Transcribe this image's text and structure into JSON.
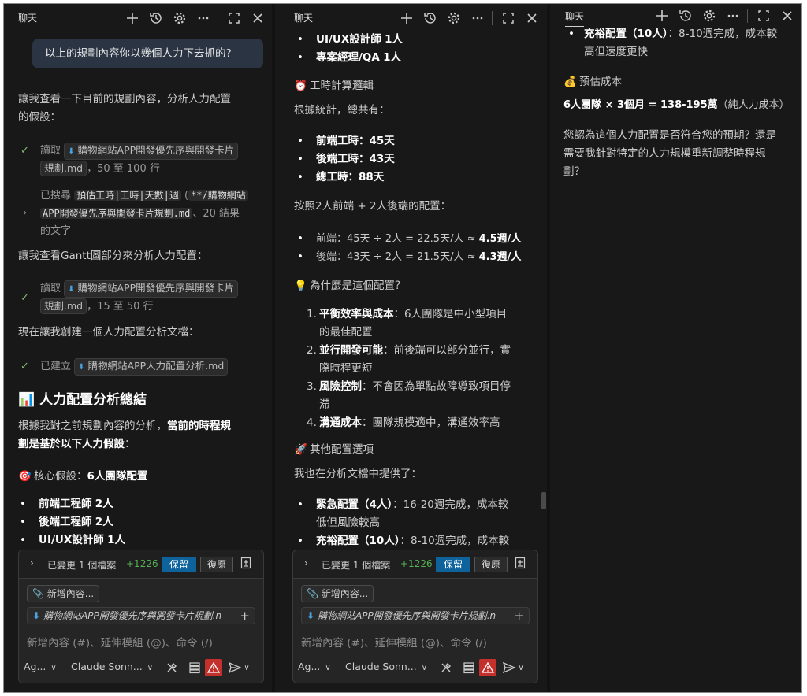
{
  "panes": [
    {
      "tab": "聊天",
      "user_message": "以上的規劃內容你以幾個人力下去抓的?",
      "intro": [
        "讓我查看一下目前的規劃內容，分析人力配置",
        "的假設："
      ],
      "tool_read1": {
        "verb": "讀取",
        "file_a": "購物網站APP開發優先序與開發卡片",
        "file_b": "規劃.md",
        "range": "，50 至 100 行"
      },
      "tool_search": {
        "verb": "已搜尋",
        "query": "預估工時|工時|天數|週",
        "path": "**/購物網站",
        "path_b": "APP開發優先序與開發卡片規劃.md",
        "results": "、20 結果",
        "tail": "的文字",
        "open_paren": "("
      },
      "gantt_line": "讓我查看Gantt圖部分來分析人力配置：",
      "tool_read2": {
        "verb": "讀取",
        "file_a": "購物網站APP開發優先序與開發卡片",
        "file_b": "規劃.md",
        "range": "，15 至 50 行"
      },
      "create_line": "現在讓我創建一個人力配置分析文檔：",
      "tool_created": {
        "verb": "已建立",
        "file": "購物網站APP人力配置分析.md"
      },
      "heading_icon": "📊",
      "heading": "人力配置分析總結",
      "analysis_a": "根據我對之前規劃內容的分析，",
      "analysis_b": "當前的時程規",
      "analysis_c": "劃是基於以下人力假設",
      "analysis_colon": "：",
      "core_icon": "🎯",
      "core_label": "核心假設：",
      "core_value": "6人團隊配置",
      "roles": [
        {
          "name": "前端工程師",
          "count": "2人"
        },
        {
          "name": "後端工程師",
          "count": "2人"
        },
        {
          "name": "UI/UX設計師",
          "count": "1人"
        }
      ]
    },
    {
      "tab": "聊天",
      "roles_top": [
        {
          "name": "UI/UX設計師",
          "count": "1人"
        },
        {
          "name": "專案經理/QA",
          "count": "1人"
        }
      ],
      "calc_icon": "⏰",
      "calc_heading": "工時計算邏輯",
      "stats_intro": "根據統計，總共有：",
      "totals": [
        {
          "label": "前端工時：",
          "value": "45天"
        },
        {
          "label": "後端工時：",
          "value": "43天"
        },
        {
          "label": "總工時：",
          "value": "88天"
        }
      ],
      "config_line": "按照2人前端 + 2人後端的配置：",
      "calc_rows": [
        {
          "text": "前端：45天 ÷ 2人 = 22.5天/人 ≈ ",
          "bold": "4.5週/人"
        },
        {
          "text": "後端：43天 ÷ 2人 = 21.5天/人 ≈ ",
          "bold": "4.3週/人"
        }
      ],
      "why_icon": "💡",
      "why_heading": "為什麼是這個配置？",
      "reasons": [
        {
          "num": "1.",
          "bold": "平衡效率與成本",
          "text": "：6人團隊是中小型項目",
          "cont": "的最佳配置"
        },
        {
          "num": "2.",
          "bold": "並行開發可能",
          "text": "：前後端可以部分並行，實",
          "cont": "際時程更短"
        },
        {
          "num": "3.",
          "bold": "風險控制",
          "text": "：不會因為單點故障導致項目停",
          "cont": "滯"
        },
        {
          "num": "4.",
          "bold": "溝通成本",
          "text": "：團隊規模適中，溝通效率高",
          "cont": ""
        }
      ],
      "other_icon": "🚀",
      "other_heading": "其他配置選項",
      "other_intro": "我也在分析文檔中提供了：",
      "options": [
        {
          "bold": "緊急配置（4人）",
          "text": "：16-20週完成，成本較",
          "cont": "低但風險較高"
        },
        {
          "bold": "充裕配置（10人）",
          "text": "：8-10週完成，成本較",
          "cont": ""
        }
      ]
    },
    {
      "tab": "聊天",
      "option_top": {
        "bold": "充裕配置（10人）",
        "text": "：8-10週完成，成本較",
        "cont": "高但速度更快"
      },
      "cost_icon": "💰",
      "cost_heading": "預估成本",
      "cost_line_bold": "6人團隊 × 3個月 = 138-195萬",
      "cost_line_rest": "（純人力成本）",
      "question": [
        "您認為這個人力配置是否符合您的預期？還是",
        "需要我針對特定的人力規模重新調整時程規",
        "劃？"
      ]
    }
  ],
  "composer": {
    "changes_label": "已變更 1 個檔案",
    "additions": "+1226",
    "keep_label": "保留",
    "undo_label": "復原",
    "add_context_label": "新增內容...",
    "attached_file": "購物網站APP開發優先序與開發卡片規劃.n",
    "placeholder": "新增內容 (#)、延伸模組 (@)、命令 (/)",
    "agent_label": "Ag...",
    "model_label": "Claude Sonn..."
  },
  "colors": {
    "accent": "#0e639c",
    "success": "#54b054",
    "warning": "#c4302b",
    "background": "#181818"
  }
}
